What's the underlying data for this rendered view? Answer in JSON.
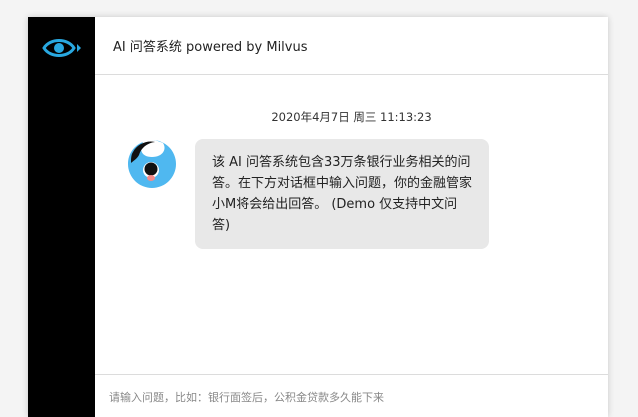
{
  "header": {
    "title": "AI 问答系统 powered by Milvus"
  },
  "sidebar": {
    "logo_icon": "eye-icon",
    "accent_color": "#29a8e0"
  },
  "chat": {
    "timestamp": "2020年4月7日 周三 11:13:23",
    "messages": [
      {
        "sender_icon": "bot-avatar-icon",
        "text": "该 AI 问答系统包含33万条银行业务相关的问答。在下方对话框中输入问题，你的金融管家小M将会给出回答。 (Demo 仅支持中文问答)"
      }
    ]
  },
  "input": {
    "placeholder": "请输入问题，比如：银行面签后，公积金贷款多久能下来",
    "value": ""
  }
}
